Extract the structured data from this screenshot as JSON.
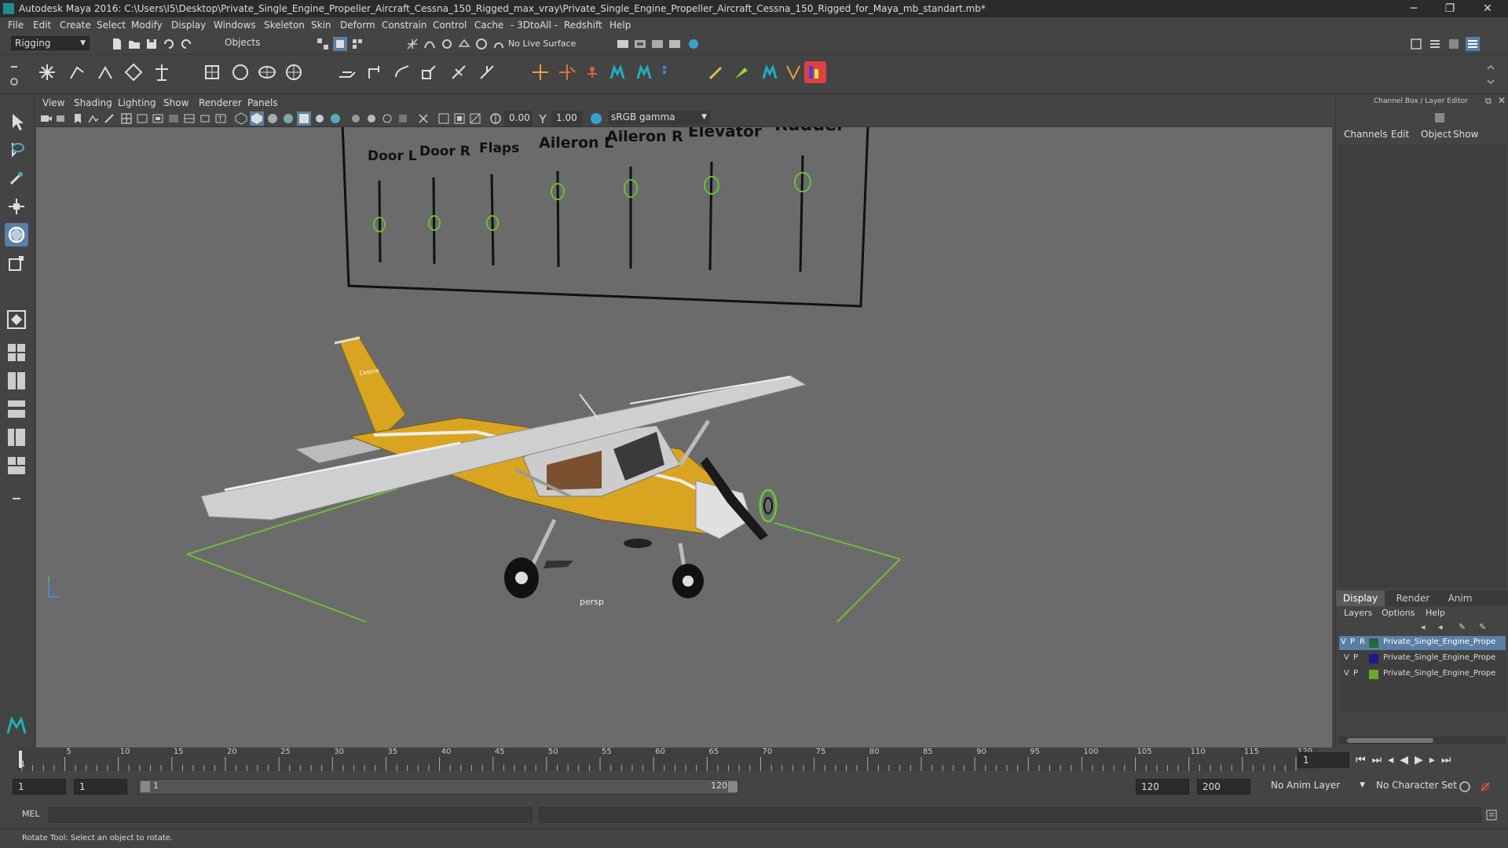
{
  "window": {
    "title": "Autodesk Maya 2016: C:\\Users\\I5\\Desktop\\Private_Single_Engine_Propeller_Aircraft_Cessna_150_Rigged_max_vray\\Private_Single_Engine_Propeller_Aircraft_Cessna_150_Rigged_for_Maya_mb_standart.mb*",
    "minimize": "─",
    "maximize": "❐",
    "close": "✕"
  },
  "menubar": [
    "File",
    "Edit",
    "Create",
    "Select",
    "Modify",
    "Display",
    "Windows",
    "Skeleton",
    "Skin",
    "Deform",
    "Constrain",
    "Control",
    "Cache",
    "- 3DtoAll -",
    "Redshift",
    "Help"
  ],
  "toolbar": {
    "mode": "Rigging",
    "objects_dropdown": "Objects",
    "live_surface": "No Live Surface"
  },
  "viewport": {
    "menus": [
      "View",
      "Shading",
      "Lighting",
      "Show",
      "Renderer",
      "Panels"
    ],
    "near_value": "0.00",
    "far_value": "1.00",
    "color_space": "sRGB gamma",
    "camera_label": "persp",
    "rig_panel_labels": [
      "Door L",
      "Door R",
      "Flaps",
      "Aileron L",
      "Aileron R",
      "Elevator",
      "Rudder"
    ],
    "wing_text": "Cessna"
  },
  "channel_box": {
    "title": "Channel Box / Layer Editor",
    "tabs": [
      "Channels",
      "Edit",
      "Object",
      "Show"
    ],
    "layer_tabs": [
      "Display",
      "Render",
      "Anim"
    ],
    "layer_menu": [
      "Layers",
      "Options",
      "Help"
    ],
    "layers": [
      {
        "v": "V",
        "p": "P",
        "r": "R",
        "color": "#1e6b3a",
        "name": "Private_Single_Engine_Prope",
        "selected": true
      },
      {
        "v": "V",
        "p": "P",
        "r": "",
        "color": "#1a1a8a",
        "name": "Private_Single_Engine_Prope",
        "selected": false
      },
      {
        "v": "V",
        "p": "P",
        "r": "",
        "color": "#6aaa2a",
        "name": "Private_Single_Engine_Prope",
        "selected": false
      }
    ]
  },
  "timeline": {
    "ticks": [
      "5",
      "10",
      "15",
      "20",
      "25",
      "30",
      "35",
      "40",
      "45",
      "50",
      "55",
      "60",
      "65",
      "70",
      "75",
      "80",
      "85",
      "90",
      "95",
      "100",
      "105",
      "110",
      "115",
      "120"
    ],
    "current_frame_start": "1",
    "current_frame": "1"
  },
  "range": {
    "start": "1",
    "playback_start": "1",
    "slider_start": "1",
    "slider_end": "120",
    "playback_end": "120",
    "end": "200",
    "anim_layer": "No Anim Layer",
    "character_set": "No Character Set"
  },
  "mel": {
    "label": "MEL"
  },
  "status": {
    "text": "Rotate Tool: Select an object to rotate."
  },
  "colors": {
    "accent_select": "#5a7fa5",
    "rig_control_green": "#6abf3a",
    "plane_yellow": "#d9a521"
  }
}
